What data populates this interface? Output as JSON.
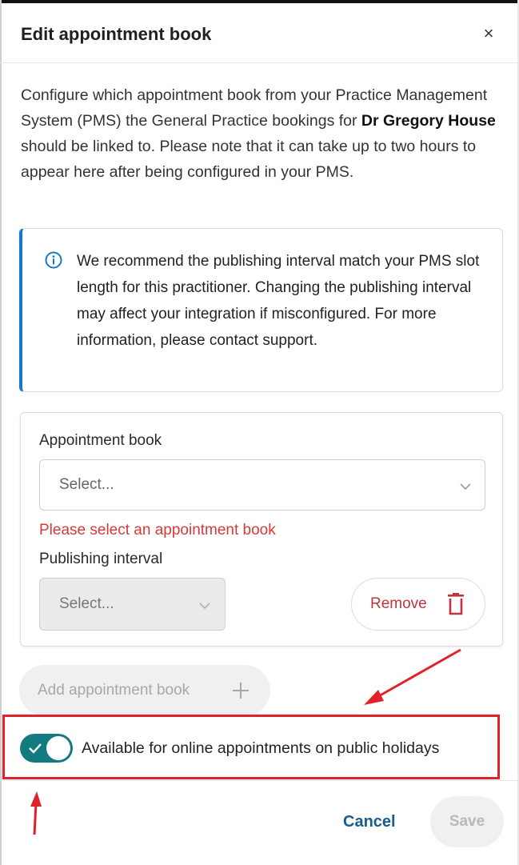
{
  "dialog": {
    "title": "Edit appointment book",
    "close_label": "×"
  },
  "description": {
    "part1": "Configure which appointment book from your Practice Management System (PMS) the General Practice bookings for ",
    "practitioner": "Dr Gregory House",
    "part2": " should be linked to. Please note that it can take up to two hours to appear here after being configured in your PMS."
  },
  "info_alert": {
    "icon": "info-circle-icon",
    "text": "We recommend the publishing interval match your PMS slot length for this practitioner. Changing the publishing interval may affect your integration if misconfigured. For more information, please contact support."
  },
  "appointment_card": {
    "book_label": "Appointment book",
    "book_value": "Select...",
    "book_error": "Please select an appointment book",
    "interval_label": "Publishing interval",
    "interval_value": "Select...",
    "remove_label": "Remove"
  },
  "add_book_label": "Add appointment book",
  "holiday_toggle": {
    "label": "Available for online appointments on public holidays",
    "checked": true
  },
  "footer": {
    "cancel_label": "Cancel",
    "save_label": "Save"
  },
  "colors": {
    "accent_teal": "#137a7f",
    "info_blue": "#1778c9",
    "error_red": "#d43a3a",
    "annotation_red": "#e0232a",
    "link_blue": "#165d8c"
  }
}
